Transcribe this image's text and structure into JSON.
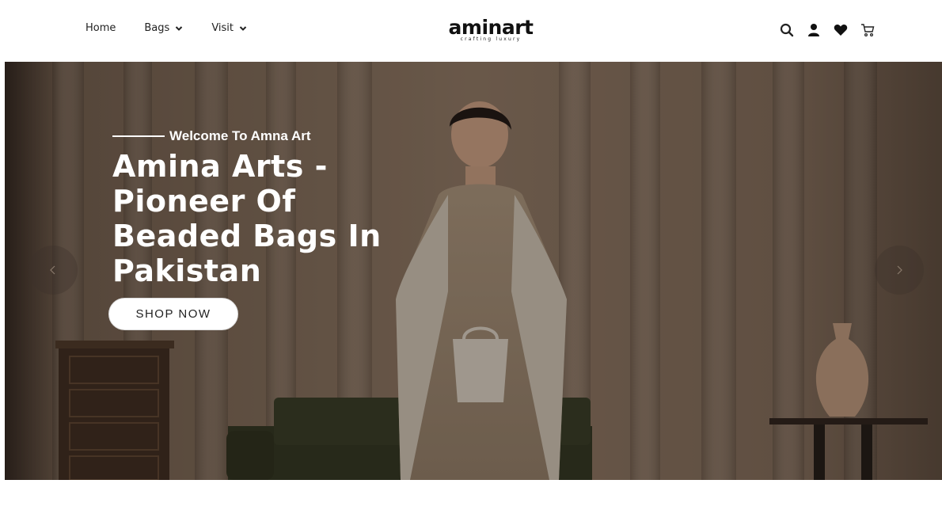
{
  "header": {
    "nav": [
      {
        "label": "Home",
        "has_dropdown": false
      },
      {
        "label": "Bags",
        "has_dropdown": true
      },
      {
        "label": "Visit",
        "has_dropdown": true
      }
    ],
    "logo": {
      "word": "aminart",
      "tagline": "crafting luxury"
    },
    "icons": [
      "search-icon",
      "user-icon",
      "heart-icon",
      "cart-icon"
    ]
  },
  "hero": {
    "welcome": "Welcome To Amna Art",
    "headline_lines": [
      "Amina Arts -",
      "Pioneer Of",
      "Beaded Bags In",
      "Pakistan"
    ],
    "cta": "SHOP NOW"
  },
  "colors": {
    "text": "#111111",
    "hero_overlay": "#3a2f27",
    "button_bg": "#ffffff"
  }
}
